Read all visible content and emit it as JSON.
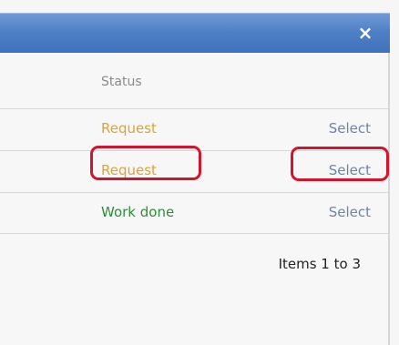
{
  "window": {
    "close_symbol": "×"
  },
  "table": {
    "header": {
      "status": "Status"
    },
    "rows": [
      {
        "status": "Request",
        "status_color": "#d6a63b",
        "action": "Select"
      },
      {
        "status": "Request",
        "status_color": "#d6a63b",
        "action": "Select"
      },
      {
        "status": "Work done",
        "status_color": "#2f8b3b",
        "action": "Select"
      }
    ]
  },
  "footer": {
    "items_text": "Items 1 to 3"
  },
  "colors": {
    "titlebar": "#4f80c6",
    "highlight": "#d4142c",
    "select_link": "#6e84a9"
  }
}
